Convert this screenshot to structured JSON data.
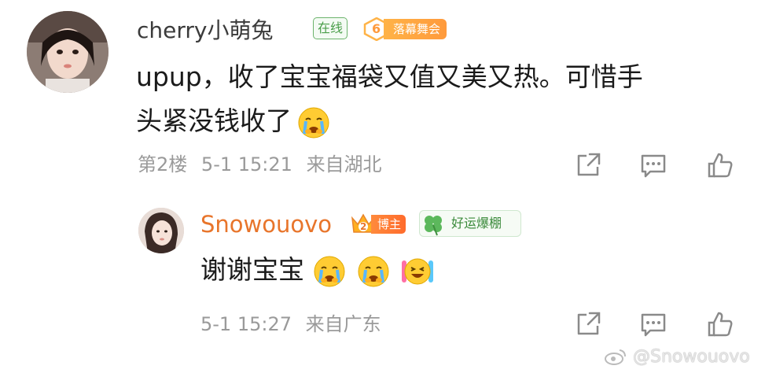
{
  "comment": {
    "username": "cherry小萌兔",
    "badges": {
      "online": "在线",
      "fan_level": "6",
      "fan_label": "落幕舞会"
    },
    "text_line1": "upup，收了宝宝福袋又值又美又热。可惜手",
    "text_line2": "头紧没钱收了",
    "floor": "第2楼",
    "timestamp": "5-1 15:21",
    "location": "来自湖北",
    "emoji": [
      "crying-emoji"
    ]
  },
  "reply": {
    "username": "Snowouovo",
    "badges": {
      "host_level": "2",
      "host_label": "博主",
      "luck_label": "好运爆棚"
    },
    "text": "谢谢宝宝",
    "timestamp": "5-1 15:27",
    "location": "来自广东",
    "emoji": [
      "crying-emoji",
      "crying-emoji",
      "excited-emoji"
    ]
  },
  "watermark": "@Snowouovo",
  "colors": {
    "host_name": "#e8752b",
    "meta_gray": "#9a9a9a",
    "online_green": "#4a9e4a",
    "fan_orange": "#ff9a3c"
  },
  "icons": [
    "share-icon",
    "comment-icon",
    "like-icon"
  ]
}
